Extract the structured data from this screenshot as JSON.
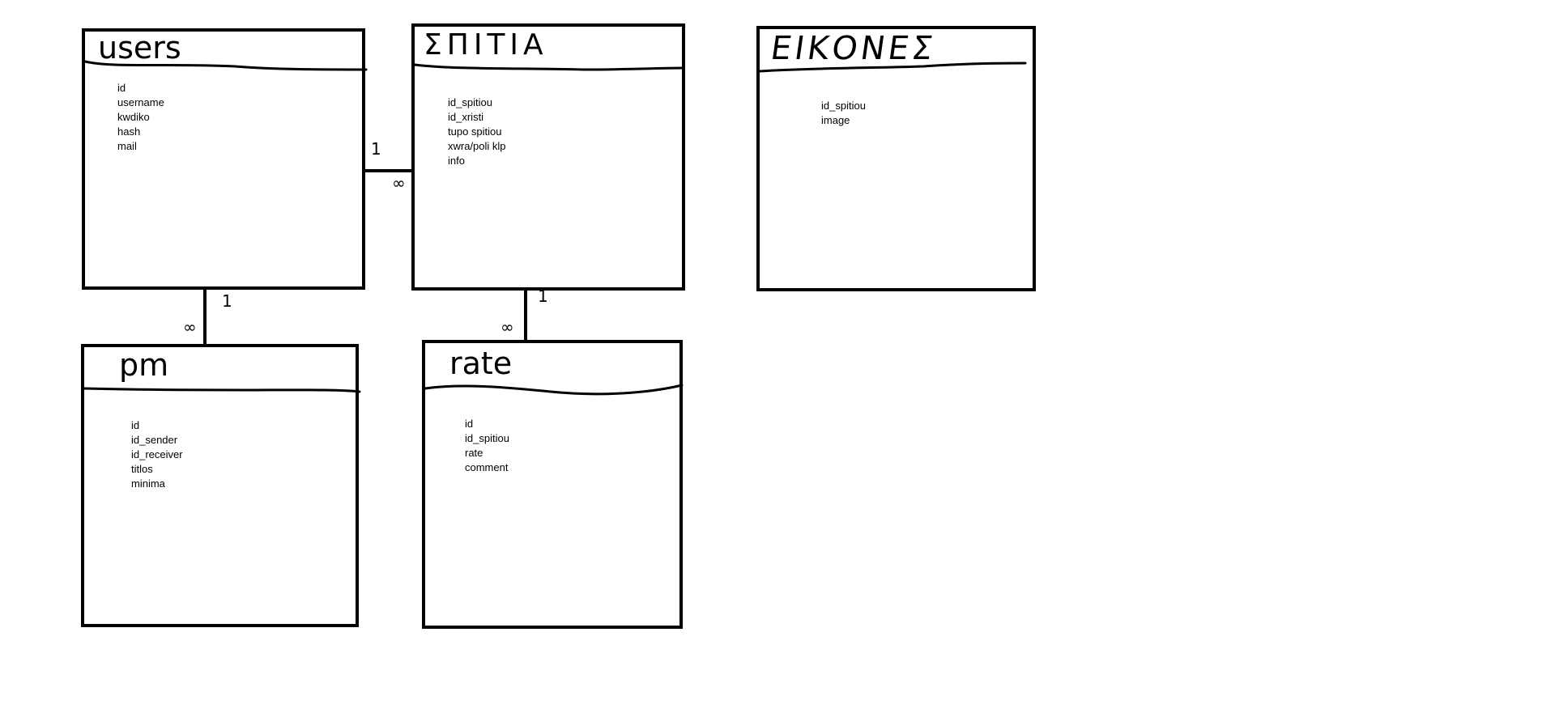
{
  "entities": {
    "users": {
      "title": "users",
      "fields": [
        "id",
        "username",
        "kwdiko",
        "hash",
        "mail"
      ]
    },
    "spitia": {
      "title": "ΣΠΙΤΙΑ",
      "fields": [
        "id_spitiou",
        "id_xristi",
        "tupo spitiou",
        "xwra/poli klp",
        "info"
      ]
    },
    "eikones": {
      "title": "ΕΙΚΟΝΕΣ",
      "fields": [
        "id_spitiou",
        "image"
      ]
    },
    "pm": {
      "title": "pm",
      "fields": [
        "id",
        "id_sender",
        "id_receiver",
        "titlos",
        "minima"
      ]
    },
    "rate": {
      "title": "rate",
      "fields": [
        "id",
        "id_spitiou",
        "rate",
        "comment"
      ]
    }
  },
  "relationships": [
    {
      "from": "users",
      "to": "spitia",
      "from_card": "1",
      "to_card": "∞"
    },
    {
      "from": "users",
      "to": "pm",
      "from_card": "1",
      "to_card": "∞"
    },
    {
      "from": "spitia",
      "to": "rate",
      "from_card": "1",
      "to_card": "∞"
    }
  ]
}
